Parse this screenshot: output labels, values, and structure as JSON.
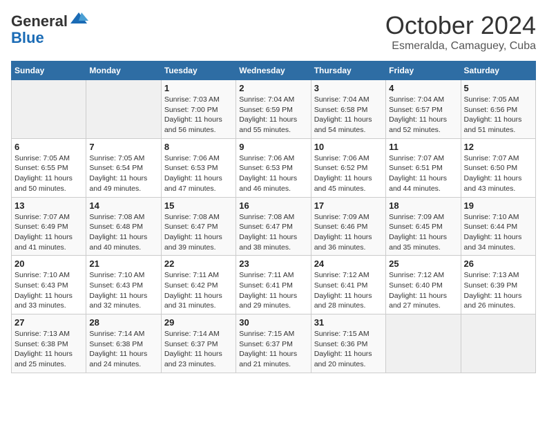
{
  "header": {
    "logo_line1": "General",
    "logo_line2": "Blue",
    "month_year": "October 2024",
    "location": "Esmeralda, Camaguey, Cuba"
  },
  "weekdays": [
    "Sunday",
    "Monday",
    "Tuesday",
    "Wednesday",
    "Thursday",
    "Friday",
    "Saturday"
  ],
  "weeks": [
    [
      {
        "day": "",
        "sunrise": "",
        "sunset": "",
        "daylight": ""
      },
      {
        "day": "",
        "sunrise": "",
        "sunset": "",
        "daylight": ""
      },
      {
        "day": "1",
        "sunrise": "Sunrise: 7:03 AM",
        "sunset": "Sunset: 7:00 PM",
        "daylight": "Daylight: 11 hours and 56 minutes."
      },
      {
        "day": "2",
        "sunrise": "Sunrise: 7:04 AM",
        "sunset": "Sunset: 6:59 PM",
        "daylight": "Daylight: 11 hours and 55 minutes."
      },
      {
        "day": "3",
        "sunrise": "Sunrise: 7:04 AM",
        "sunset": "Sunset: 6:58 PM",
        "daylight": "Daylight: 11 hours and 54 minutes."
      },
      {
        "day": "4",
        "sunrise": "Sunrise: 7:04 AM",
        "sunset": "Sunset: 6:57 PM",
        "daylight": "Daylight: 11 hours and 52 minutes."
      },
      {
        "day": "5",
        "sunrise": "Sunrise: 7:05 AM",
        "sunset": "Sunset: 6:56 PM",
        "daylight": "Daylight: 11 hours and 51 minutes."
      }
    ],
    [
      {
        "day": "6",
        "sunrise": "Sunrise: 7:05 AM",
        "sunset": "Sunset: 6:55 PM",
        "daylight": "Daylight: 11 hours and 50 minutes."
      },
      {
        "day": "7",
        "sunrise": "Sunrise: 7:05 AM",
        "sunset": "Sunset: 6:54 PM",
        "daylight": "Daylight: 11 hours and 49 minutes."
      },
      {
        "day": "8",
        "sunrise": "Sunrise: 7:06 AM",
        "sunset": "Sunset: 6:53 PM",
        "daylight": "Daylight: 11 hours and 47 minutes."
      },
      {
        "day": "9",
        "sunrise": "Sunrise: 7:06 AM",
        "sunset": "Sunset: 6:53 PM",
        "daylight": "Daylight: 11 hours and 46 minutes."
      },
      {
        "day": "10",
        "sunrise": "Sunrise: 7:06 AM",
        "sunset": "Sunset: 6:52 PM",
        "daylight": "Daylight: 11 hours and 45 minutes."
      },
      {
        "day": "11",
        "sunrise": "Sunrise: 7:07 AM",
        "sunset": "Sunset: 6:51 PM",
        "daylight": "Daylight: 11 hours and 44 minutes."
      },
      {
        "day": "12",
        "sunrise": "Sunrise: 7:07 AM",
        "sunset": "Sunset: 6:50 PM",
        "daylight": "Daylight: 11 hours and 43 minutes."
      }
    ],
    [
      {
        "day": "13",
        "sunrise": "Sunrise: 7:07 AM",
        "sunset": "Sunset: 6:49 PM",
        "daylight": "Daylight: 11 hours and 41 minutes."
      },
      {
        "day": "14",
        "sunrise": "Sunrise: 7:08 AM",
        "sunset": "Sunset: 6:48 PM",
        "daylight": "Daylight: 11 hours and 40 minutes."
      },
      {
        "day": "15",
        "sunrise": "Sunrise: 7:08 AM",
        "sunset": "Sunset: 6:47 PM",
        "daylight": "Daylight: 11 hours and 39 minutes."
      },
      {
        "day": "16",
        "sunrise": "Sunrise: 7:08 AM",
        "sunset": "Sunset: 6:47 PM",
        "daylight": "Daylight: 11 hours and 38 minutes."
      },
      {
        "day": "17",
        "sunrise": "Sunrise: 7:09 AM",
        "sunset": "Sunset: 6:46 PM",
        "daylight": "Daylight: 11 hours and 36 minutes."
      },
      {
        "day": "18",
        "sunrise": "Sunrise: 7:09 AM",
        "sunset": "Sunset: 6:45 PM",
        "daylight": "Daylight: 11 hours and 35 minutes."
      },
      {
        "day": "19",
        "sunrise": "Sunrise: 7:10 AM",
        "sunset": "Sunset: 6:44 PM",
        "daylight": "Daylight: 11 hours and 34 minutes."
      }
    ],
    [
      {
        "day": "20",
        "sunrise": "Sunrise: 7:10 AM",
        "sunset": "Sunset: 6:43 PM",
        "daylight": "Daylight: 11 hours and 33 minutes."
      },
      {
        "day": "21",
        "sunrise": "Sunrise: 7:10 AM",
        "sunset": "Sunset: 6:43 PM",
        "daylight": "Daylight: 11 hours and 32 minutes."
      },
      {
        "day": "22",
        "sunrise": "Sunrise: 7:11 AM",
        "sunset": "Sunset: 6:42 PM",
        "daylight": "Daylight: 11 hours and 31 minutes."
      },
      {
        "day": "23",
        "sunrise": "Sunrise: 7:11 AM",
        "sunset": "Sunset: 6:41 PM",
        "daylight": "Daylight: 11 hours and 29 minutes."
      },
      {
        "day": "24",
        "sunrise": "Sunrise: 7:12 AM",
        "sunset": "Sunset: 6:41 PM",
        "daylight": "Daylight: 11 hours and 28 minutes."
      },
      {
        "day": "25",
        "sunrise": "Sunrise: 7:12 AM",
        "sunset": "Sunset: 6:40 PM",
        "daylight": "Daylight: 11 hours and 27 minutes."
      },
      {
        "day": "26",
        "sunrise": "Sunrise: 7:13 AM",
        "sunset": "Sunset: 6:39 PM",
        "daylight": "Daylight: 11 hours and 26 minutes."
      }
    ],
    [
      {
        "day": "27",
        "sunrise": "Sunrise: 7:13 AM",
        "sunset": "Sunset: 6:38 PM",
        "daylight": "Daylight: 11 hours and 25 minutes."
      },
      {
        "day": "28",
        "sunrise": "Sunrise: 7:14 AM",
        "sunset": "Sunset: 6:38 PM",
        "daylight": "Daylight: 11 hours and 24 minutes."
      },
      {
        "day": "29",
        "sunrise": "Sunrise: 7:14 AM",
        "sunset": "Sunset: 6:37 PM",
        "daylight": "Daylight: 11 hours and 23 minutes."
      },
      {
        "day": "30",
        "sunrise": "Sunrise: 7:15 AM",
        "sunset": "Sunset: 6:37 PM",
        "daylight": "Daylight: 11 hours and 21 minutes."
      },
      {
        "day": "31",
        "sunrise": "Sunrise: 7:15 AM",
        "sunset": "Sunset: 6:36 PM",
        "daylight": "Daylight: 11 hours and 20 minutes."
      },
      {
        "day": "",
        "sunrise": "",
        "sunset": "",
        "daylight": ""
      },
      {
        "day": "",
        "sunrise": "",
        "sunset": "",
        "daylight": ""
      }
    ]
  ]
}
